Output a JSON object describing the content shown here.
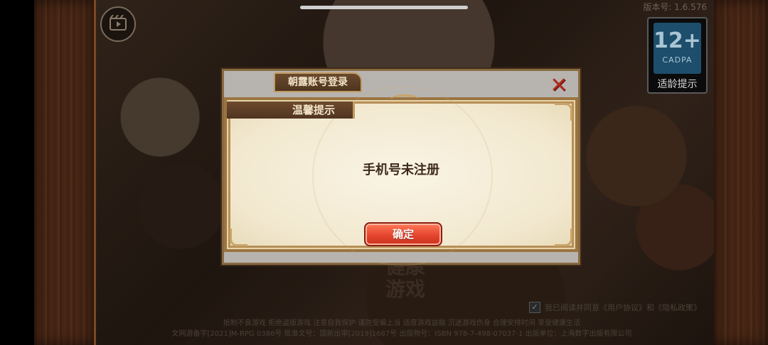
{
  "status": {
    "version": "版本号: 1.6.576"
  },
  "age_rating": {
    "number": "12+",
    "org": "CADPA",
    "label": "适龄提示"
  },
  "login_panel": {
    "title": "朝露账号登录",
    "close_glyph": "✕"
  },
  "dialog": {
    "title": "温馨提示",
    "message": "手机号未注册",
    "confirm_label": "确定"
  },
  "background": {
    "watermark": "健康\n游戏",
    "health_notice": "抵制不良游戏 拒绝盗版游戏 注意自我保护 谨防受骗上当 适度游戏益脑 沉迷游戏伤身 合理安排时间 享受健康生活",
    "license_line": "文网游备字[2021]M-RPG 0386号 批准文号：国新出审[2019]1687号 出版物号：ISBN 978-7-498-07037-1 出版单位：上海数字出版有限公司",
    "agreement": "我已阅读并同意《用户协议》和《隐私政策》"
  }
}
